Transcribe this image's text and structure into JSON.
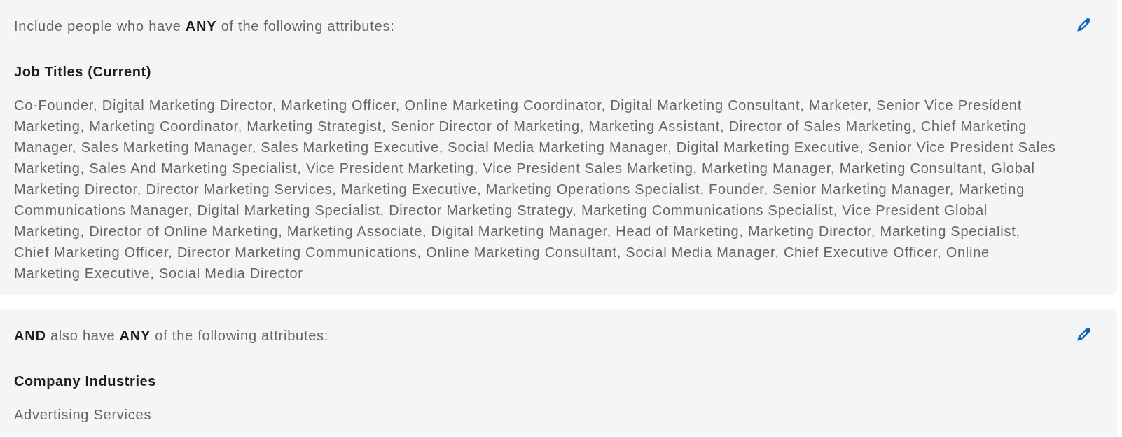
{
  "criteria_groups": [
    {
      "intro": "Include people who have **ANY** of the following attributes:",
      "filters": [
        {
          "label": "Job Titles (Current)",
          "values": "Co-Founder, Digital Marketing Director, Marketing Officer, Online Marketing Coordinator, Digital Marketing Consultant, Marketer, Senior Vice President Marketing, Marketing Coordinator, Marketing Strategist, Senior Director of Marketing, Marketing Assistant, Director of Sales Marketing, Chief Marketing Manager, Sales Marketing Manager, Sales Marketing Executive, Social Media Marketing Manager, Digital Marketing Executive, Senior Vice President Sales Marketing, Sales And Marketing Specialist, Vice President Marketing, Vice President Sales Marketing, Marketing Manager, Marketing Consultant, Global Marketing Director, Director Marketing Services, Marketing Executive, Marketing Operations Specialist, Founder, Senior Marketing Manager, Marketing Communications Manager, Digital Marketing Specialist, Director Marketing Strategy, Marketing Communications Specialist, Vice President Global Marketing, Director of Online Marketing, Marketing Associate, Digital Marketing Manager, Head of Marketing, Marketing Director, Marketing Specialist, Chief Marketing Officer, Director Marketing Communications, Online Marketing Consultant, Social Media Manager, Chief Executive Officer, Online Marketing Executive, Social Media Director"
        }
      ]
    },
    {
      "intro": "**AND** also have **ANY** of the following attributes:",
      "filters": [
        {
          "label": "Company Industries",
          "values": "Advertising Services"
        }
      ]
    }
  ]
}
